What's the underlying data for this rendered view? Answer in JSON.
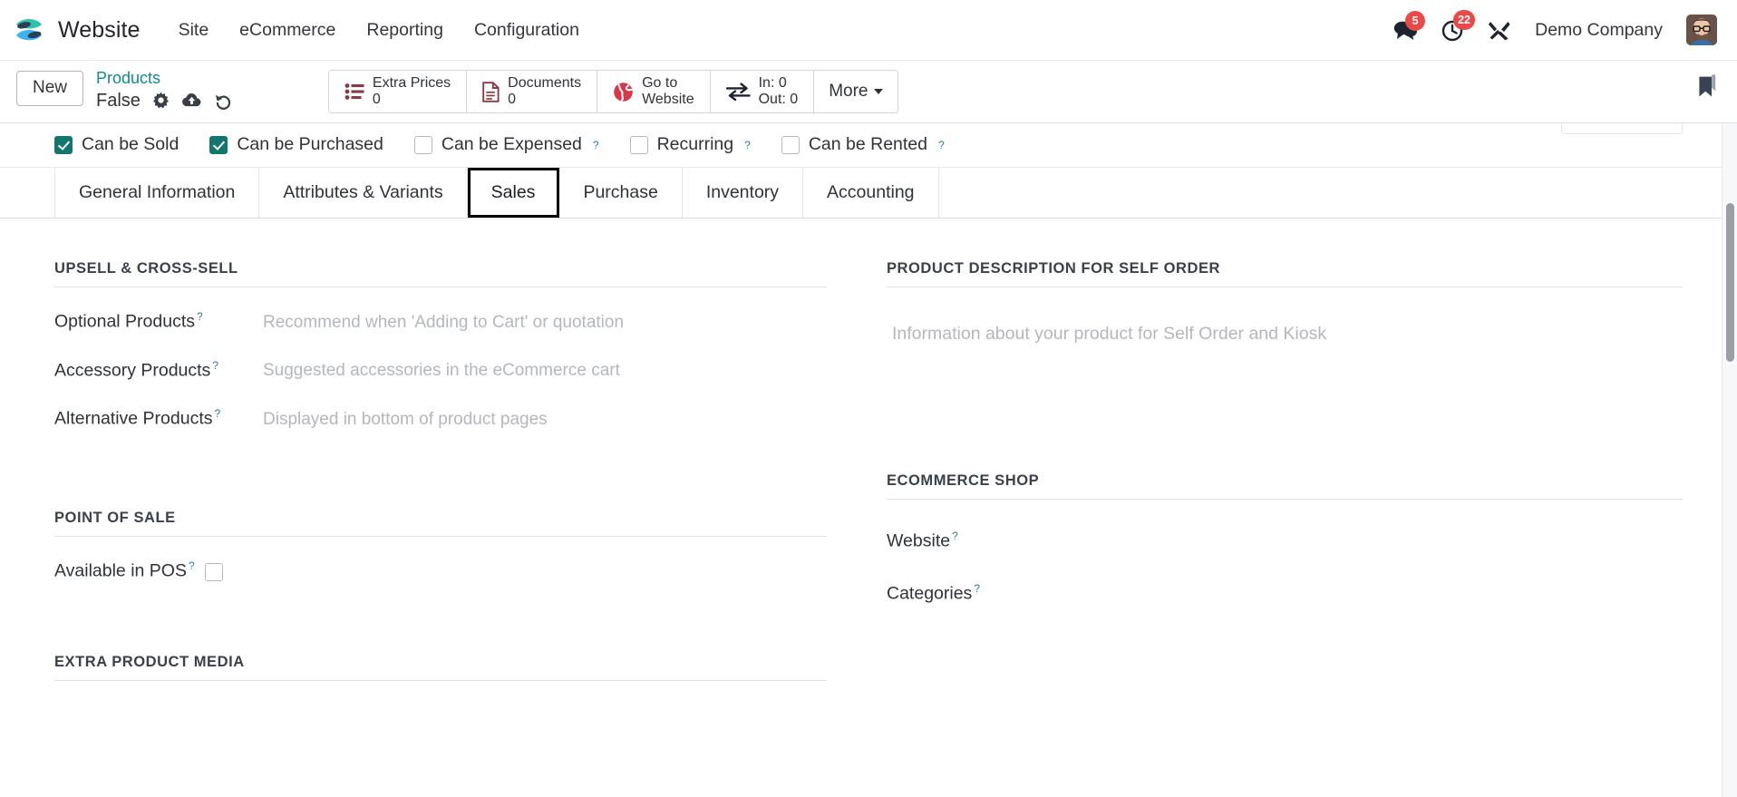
{
  "navbar": {
    "logo_icon": "website-app-logo",
    "app_name": "Website",
    "menus": [
      {
        "label": "Site"
      },
      {
        "label": "eCommerce"
      },
      {
        "label": "Reporting"
      },
      {
        "label": "Configuration"
      }
    ],
    "messages": {
      "icon": "messages-icon",
      "badge": "5"
    },
    "activities": {
      "icon": "activity-clock-icon",
      "badge": "22"
    },
    "developer_tools": {
      "icon": "developer-tools-icon"
    },
    "company": "Demo Company",
    "avatar_icon": "user-avatar"
  },
  "control_panel": {
    "new_label": "New",
    "breadcrumb_parent": "Products",
    "breadcrumb_current": "False",
    "gear_icon": "gear-icon",
    "save_icon": "cloud-save-icon",
    "discard_icon": "discard-undo-icon",
    "bookmark_icon": "bookmark-icon",
    "stat_buttons": [
      {
        "icon": "list-prices-icon",
        "label": "Extra Prices",
        "value": "0"
      },
      {
        "icon": "document-icon",
        "label": "Documents",
        "value": "0"
      },
      {
        "icon": "globe-icon",
        "label": "Go to",
        "value": "Website"
      },
      {
        "icon": "transfer-arrows-icon",
        "label": "In: 0",
        "value": "Out: 0"
      }
    ],
    "more_label": "More"
  },
  "product_flags": [
    {
      "label": "Can be Sold",
      "checked": true,
      "help": false
    },
    {
      "label": "Can be Purchased",
      "checked": true,
      "help": false
    },
    {
      "label": "Can be Expensed",
      "checked": false,
      "help": true
    },
    {
      "label": "Recurring",
      "checked": false,
      "help": true
    },
    {
      "label": "Can be Rented",
      "checked": false,
      "help": true
    }
  ],
  "tabs": [
    {
      "label": "General Information",
      "active": false
    },
    {
      "label": "Attributes & Variants",
      "active": false
    },
    {
      "label": "Sales",
      "active": true
    },
    {
      "label": "Purchase",
      "active": false
    },
    {
      "label": "Inventory",
      "active": false
    },
    {
      "label": "Accounting",
      "active": false
    }
  ],
  "sales_tab": {
    "upsell": {
      "title": "Upsell & Cross-Sell",
      "fields": [
        {
          "label": "Optional Products",
          "placeholder": "Recommend when 'Adding to Cart' or quotation",
          "help": true
        },
        {
          "label": "Accessory Products",
          "placeholder": "Suggested accessories in the eCommerce cart",
          "help": true
        },
        {
          "label": "Alternative Products",
          "placeholder": "Displayed in bottom of product pages",
          "help": true
        }
      ]
    },
    "point_of_sale": {
      "title": "Point of Sale",
      "available_label": "Available in POS",
      "available_checked": false,
      "available_help": true
    },
    "extra_media": {
      "title": "Extra Product Media"
    },
    "self_order": {
      "title": "Product Description for Self Order",
      "placeholder": "Information about your product for Self Order and Kiosk"
    },
    "ecommerce_shop": {
      "title": "eCommerce Shop",
      "fields": [
        {
          "label": "Website",
          "help": true
        },
        {
          "label": "Categories",
          "help": true
        }
      ]
    }
  },
  "colors": {
    "accent_teal": "#12766f",
    "link_teal": "#0f8a93",
    "badge_red": "#e94a49",
    "stat_icon_maroon": "#8a3a47",
    "help_blue": "#2b7fa8"
  }
}
